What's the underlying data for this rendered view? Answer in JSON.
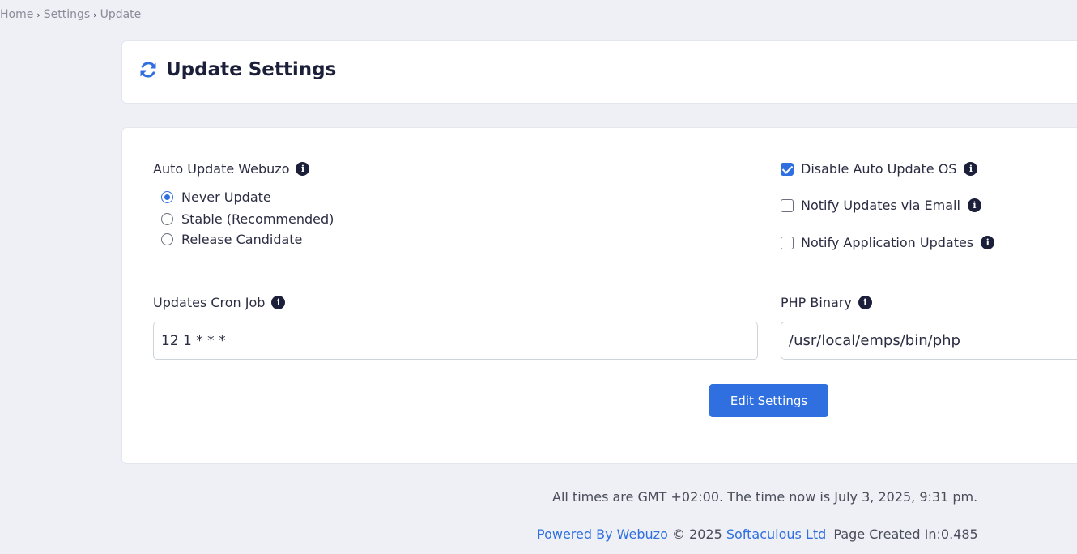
{
  "breadcrumb": {
    "items": [
      "Home",
      "Settings",
      "Update"
    ],
    "separator": "›"
  },
  "page": {
    "title": "Update Settings",
    "icon": "sync-icon"
  },
  "auto_update": {
    "label": "Auto Update Webuzo",
    "options": [
      {
        "label": "Never Update",
        "checked": true
      },
      {
        "label": "Stable (Recommended)",
        "checked": false
      },
      {
        "label": "Release Candidate",
        "checked": false
      }
    ]
  },
  "checkboxes": [
    {
      "label": "Disable Auto Update OS",
      "checked": true
    },
    {
      "label": "Notify Updates via Email",
      "checked": false
    },
    {
      "label": "Notify Application Updates",
      "checked": false
    }
  ],
  "cron": {
    "label": "Updates Cron Job",
    "value": "12 1 * * *"
  },
  "php": {
    "label": "PHP Binary",
    "value": "/usr/local/emps/bin/php"
  },
  "edit_button": "Edit Settings",
  "footer": {
    "time_text": "All times are GMT +02:00. The time now is July 3, 2025, 9:31 pm.",
    "powered_by": "Powered By Webuzo",
    "copyright": "© 2025",
    "company": "Softaculous Ltd",
    "page_created": "Page Created In:0.485"
  },
  "colors": {
    "accent": "#2f6fe0",
    "background": "#eef0f5",
    "text": "#2b2d42"
  }
}
